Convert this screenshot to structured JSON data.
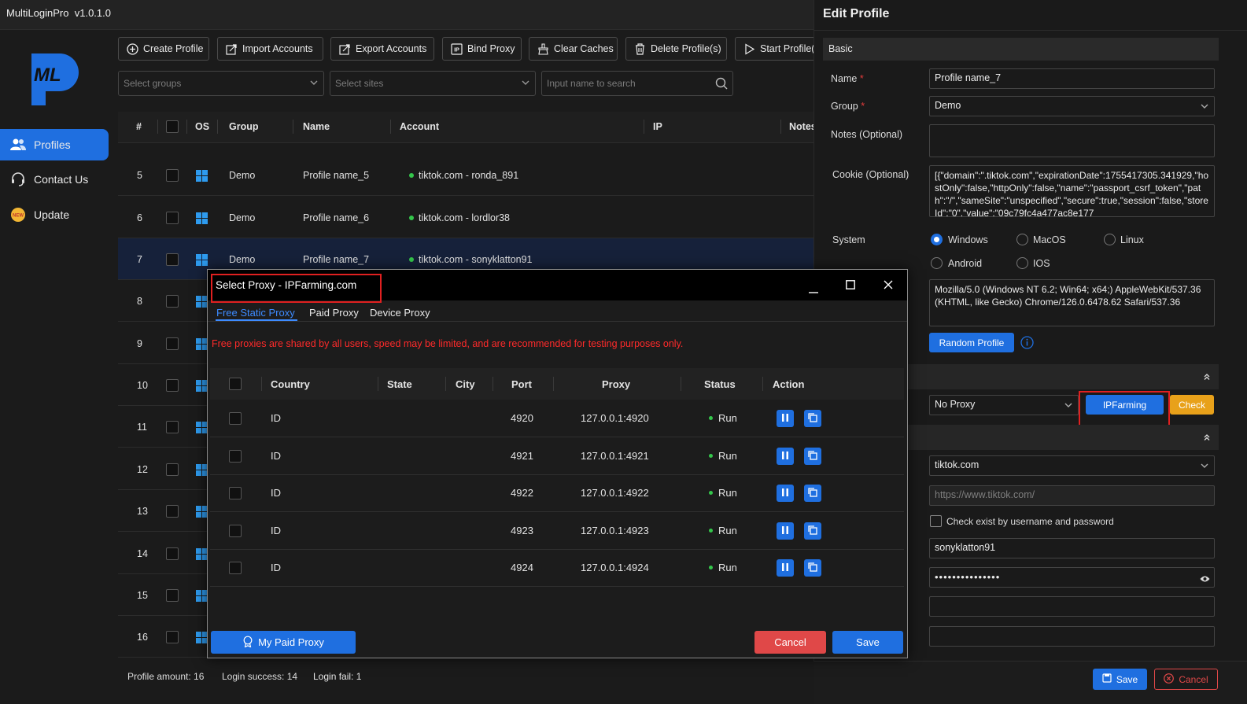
{
  "app": {
    "title": "MultiLoginPro",
    "version": "v1.0.1.0",
    "logo_text": "ML"
  },
  "sidebar": {
    "items": [
      {
        "label": "Profiles",
        "icon": "users-icon",
        "active": true
      },
      {
        "label": "Contact Us",
        "icon": "headset-icon",
        "active": false
      },
      {
        "label": "Update",
        "icon": "new-badge-icon",
        "active": false
      }
    ]
  },
  "toolbar": {
    "create": "Create Profile",
    "import": "Import Accounts",
    "export": "Export Accounts",
    "bind": "Bind Proxy",
    "clear": "Clear Caches",
    "delete": "Delete Profile(s)",
    "start": "Start Profile(s)"
  },
  "filters": {
    "groups_placeholder": "Select groups",
    "sites_placeholder": "Select sites",
    "search_placeholder": "Input name to search"
  },
  "table": {
    "headers": {
      "num": "#",
      "os": "OS",
      "group": "Group",
      "name": "Name",
      "account": "Account",
      "ip": "IP",
      "notes": "Notes"
    },
    "rows": [
      {
        "num": "5",
        "group": "Demo",
        "name": "Profile name_5",
        "account": "tiktok.com - ronda_891"
      },
      {
        "num": "6",
        "group": "Demo",
        "name": "Profile name_6",
        "account": "tiktok.com - lordlor38"
      },
      {
        "num": "7",
        "group": "Demo",
        "name": "Profile name_7",
        "account": "tiktok.com - sonyklatton91",
        "selected": true
      },
      {
        "num": "8"
      },
      {
        "num": "9"
      },
      {
        "num": "10"
      },
      {
        "num": "11"
      },
      {
        "num": "12"
      },
      {
        "num": "13"
      },
      {
        "num": "14"
      },
      {
        "num": "15"
      },
      {
        "num": "16"
      }
    ]
  },
  "status_bar": {
    "amount": "Profile amount: 16",
    "success": "Login success: 14",
    "fail": "Login fail: 1"
  },
  "edit": {
    "title": "Edit Profile",
    "basic": "Basic",
    "name_label": "Name",
    "name_value": "Profile name_7",
    "group_label": "Group",
    "group_value": "Demo",
    "notes_label": "Notes (Optional)",
    "cookie_label": "Cookie (Optional)",
    "cookie_value": "[{\"domain\":\".tiktok.com\",\"expirationDate\":1755417305.341929,\"hostOnly\":false,\"httpOnly\":false,\"name\":\"passport_csrf_token\",\"path\":\"/\",\"sameSite\":\"unspecified\",\"secure\":true,\"session\":false,\"storeId\":\"0\",\"value\":\"09c79fc4a477ac8e177",
    "system_label": "System",
    "os_options": [
      "Windows",
      "MacOS",
      "Linux",
      "Android",
      "IOS"
    ],
    "os_selected": "Windows",
    "user_agent": "Mozilla/5.0 (Windows NT 6.2; Win64; x64;) AppleWebKit/537.36 (KHTML, like Gecko) Chrome/126.0.6478.62 Safari/537.36",
    "random_profile": "Random Profile",
    "proxy_value": "No Proxy",
    "ipfarming": "IPFarming",
    "check": "Check",
    "site_value": "tiktok.com",
    "url_placeholder": "https://www.tiktok.com/",
    "check_exist": "Check exist by username and password",
    "username": "sonyklatton91",
    "password": "•••••••••••••••",
    "save": "Save",
    "cancel": "Cancel"
  },
  "modal": {
    "title": "Select Proxy - IPFarming.com",
    "tabs": [
      "Free Static Proxy",
      "Paid Proxy",
      "Device Proxy"
    ],
    "active_tab": "Free Static Proxy",
    "warning": "Free proxies are shared by all users, speed may be limited, and are recommended for testing purposes only.",
    "headers": {
      "country": "Country",
      "state": "State",
      "city": "City",
      "port": "Port",
      "proxy": "Proxy",
      "status": "Status",
      "action": "Action"
    },
    "rows": [
      {
        "country": "ID",
        "port": "4920",
        "proxy": "127.0.0.1:4920",
        "status": "Run"
      },
      {
        "country": "ID",
        "port": "4921",
        "proxy": "127.0.0.1:4921",
        "status": "Run"
      },
      {
        "country": "ID",
        "port": "4922",
        "proxy": "127.0.0.1:4922",
        "status": "Run"
      },
      {
        "country": "ID",
        "port": "4923",
        "proxy": "127.0.0.1:4923",
        "status": "Run"
      },
      {
        "country": "ID",
        "port": "4924",
        "proxy": "127.0.0.1:4924",
        "status": "Run"
      }
    ],
    "my_paid": "My Paid Proxy",
    "cancel": "Cancel",
    "save": "Save"
  },
  "colors": {
    "accent": "#1f6fe0",
    "danger": "#e04848",
    "warning_text": "#ff2a2a",
    "check": "#e8a11a",
    "highlight_box": "#e02020",
    "success": "#34c64b"
  }
}
